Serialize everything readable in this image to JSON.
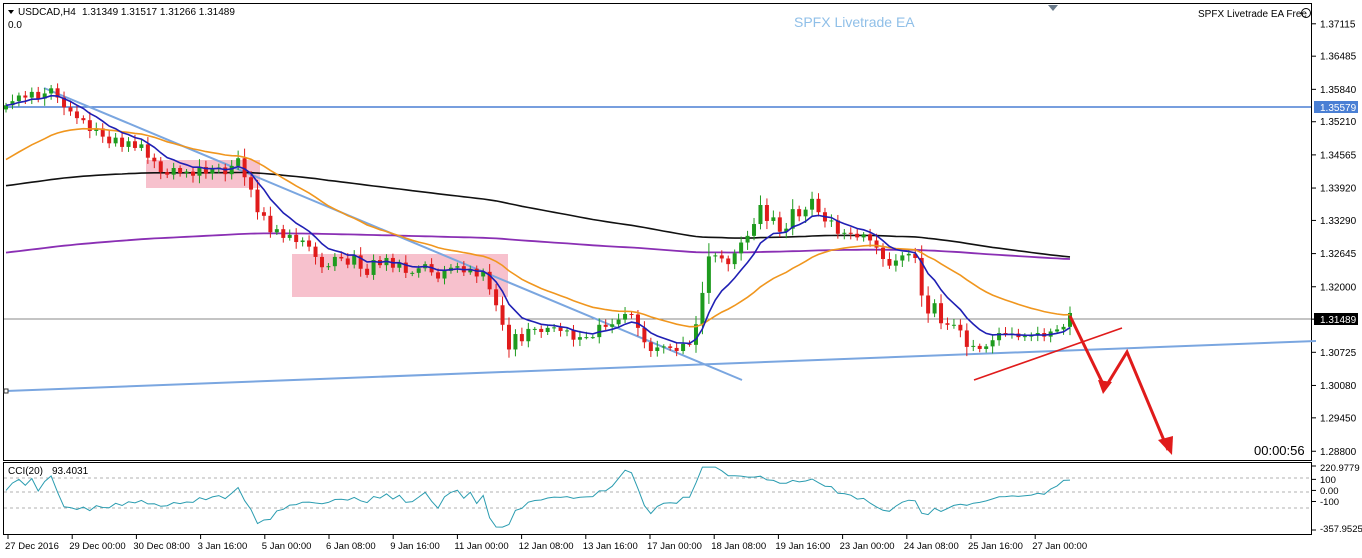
{
  "header": {
    "symbol_label": "USDCAD,H4",
    "ohlc": "1.31349 1.31517 1.31266 1.31489",
    "sub_value": "0.0",
    "ea_title": "SPFX Livetrade EA",
    "ea_badge": "SPFX Livetrade EA Free",
    "countdown": "00:00:56"
  },
  "colors": {
    "bull": "#1e9b1e",
    "bear": "#e01b1b",
    "ema_fast": "#1f1fb4",
    "ema_mid": "#f0961e",
    "ma_black": "#111111",
    "ma_purple": "#8a2fb4",
    "trend": "#7aa6e0",
    "zone": "#f6b6c4",
    "cci": "#2a9cb0",
    "arrow": "#e01b1b",
    "resistance": "#4a7fd4"
  },
  "chart_data": {
    "type": "line",
    "y_range": [
      1.2863,
      1.375
    ],
    "price_ticks": [
      "1.37115",
      "1.36485",
      "1.35840",
      "1.35210",
      "1.34565",
      "1.33920",
      "1.33290",
      "1.32645",
      "1.32000",
      "1.31370",
      "1.30725",
      "1.30080",
      "1.29450",
      "1.28800"
    ],
    "level_labels": {
      "resistance": "1.35579",
      "current": "1.31489"
    },
    "resistance_level": 1.35579,
    "current_price": 1.31489,
    "x_labels": [
      "27 Dec 2016",
      "29 Dec 00:00",
      "30 Dec 08:00",
      "3 Jan 16:00",
      "5 Jan 00:00",
      "6 Jan 08:00",
      "9 Jan 16:00",
      "11 Jan 00:00",
      "12 Jan 08:00",
      "13 Jan 16:00",
      "17 Jan 00:00",
      "18 Jan 08:00",
      "19 Jan 16:00",
      "23 Jan 00:00",
      "24 Jan 08:00",
      "25 Jan 16:00",
      "27 Jan 00:00"
    ],
    "closes": [
      1.3553,
      1.3561,
      1.3572,
      1.3568,
      1.3579,
      1.3566,
      1.3576,
      1.3586,
      1.3568,
      1.3549,
      1.3541,
      1.3528,
      1.3524,
      1.3503,
      1.3508,
      1.3492,
      1.3479,
      1.349,
      1.3472,
      1.3483,
      1.347,
      1.3477,
      1.3451,
      1.3444,
      1.3423,
      1.3418,
      1.3431,
      1.3421,
      1.3424,
      1.3416,
      1.3433,
      1.342,
      1.3429,
      1.3432,
      1.3419,
      1.3435,
      1.345,
      1.3413,
      1.3389,
      1.3345,
      1.3338,
      1.3306,
      1.3312,
      1.3295,
      1.3301,
      1.3287,
      1.329,
      1.3278,
      1.3258,
      1.3238,
      1.324,
      1.3258,
      1.3255,
      1.3243,
      1.3261,
      1.3235,
      1.3223,
      1.3252,
      1.3242,
      1.3256,
      1.3237,
      1.3247,
      1.3227,
      1.3227,
      1.3236,
      1.3244,
      1.3228,
      1.3216,
      1.3231,
      1.3237,
      1.324,
      1.3228,
      1.3235,
      1.322,
      1.3229,
      1.3195,
      1.3164,
      1.3126,
      1.3078,
      1.3108,
      1.3094,
      1.3118,
      1.3118,
      1.3112,
      1.312,
      1.3121,
      1.3114,
      1.3115,
      1.3097,
      1.3102,
      1.3102,
      1.3102,
      1.3126,
      1.3122,
      1.3127,
      1.3136,
      1.3147,
      1.3146,
      1.312,
      1.3092,
      1.3075,
      1.3082,
      1.3084,
      1.3081,
      1.3075,
      1.3089,
      1.3087,
      1.3127,
      1.3188,
      1.3259,
      1.3261,
      1.3255,
      1.3244,
      1.3265,
      1.3286,
      1.3299,
      1.3322,
      1.3359,
      1.3328,
      1.3335,
      1.3307,
      1.3313,
      1.3351,
      1.3337,
      1.335,
      1.3371,
      1.3345,
      1.3327,
      1.3329,
      1.3303,
      1.3305,
      1.3303,
      1.3296,
      1.3302,
      1.329,
      1.3276,
      1.3254,
      1.3241,
      1.3251,
      1.3261,
      1.3264,
      1.3256,
      1.3183,
      1.3148,
      1.3168,
      1.3129,
      1.3126,
      1.3126,
      1.3115,
      1.3083,
      1.3085,
      1.3079,
      1.3084,
      1.3096,
      1.311,
      1.3107,
      1.3109,
      1.3102,
      1.3104,
      1.3105,
      1.311,
      1.3103,
      1.3113,
      1.3117,
      1.3122,
      1.3149
    ],
    "indicator": {
      "name": "CCI(20)",
      "value": "93.4031",
      "ticks": [
        "220.9779",
        "100",
        "0.00",
        "-100",
        "-357.9525"
      ],
      "range": [
        -357.9525,
        220.9779
      ]
    },
    "grid": false,
    "legend": "none"
  }
}
